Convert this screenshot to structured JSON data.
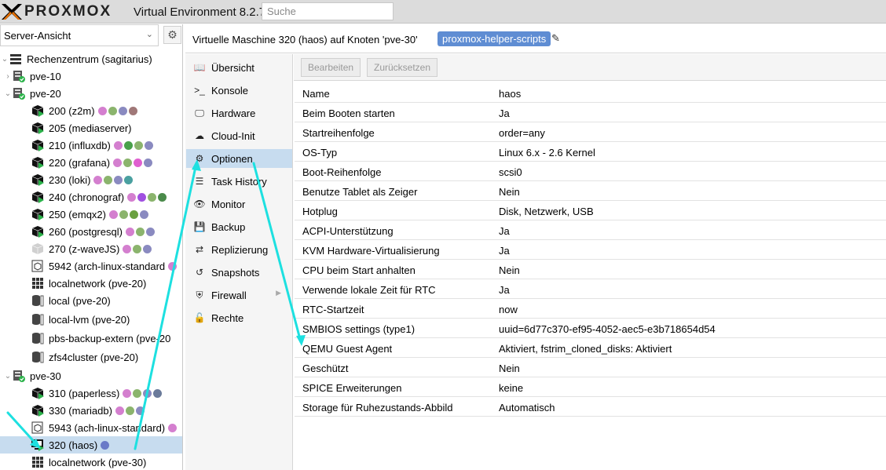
{
  "header": {
    "brand": "PROXMOX",
    "product": "Virtual Environment 8.2.7",
    "search_placeholder": "Suche"
  },
  "tree": {
    "view_label": "Server-Ansicht",
    "root": "Rechenzentrum (sagitarius)",
    "items": [
      {
        "label": "pve-10"
      },
      {
        "label": "pve-20"
      },
      {
        "label": "200 (z2m)"
      },
      {
        "label": "205 (mediaserver)"
      },
      {
        "label": "210 (influxdb)"
      },
      {
        "label": "220 (grafana)"
      },
      {
        "label": "230 (loki)"
      },
      {
        "label": "240 (chronograf)"
      },
      {
        "label": "250 (emqx2)"
      },
      {
        "label": "260 (postgresql)"
      },
      {
        "label": "270 (z-waveJS)"
      },
      {
        "label": "5942 (arch-linux-standard"
      },
      {
        "label": "localnetwork (pve-20)"
      },
      {
        "label": "local (pve-20)"
      },
      {
        "label": "local-lvm (pve-20)"
      },
      {
        "label": "pbs-backup-extern (pve-20"
      },
      {
        "label": "zfs4cluster (pve-20)"
      },
      {
        "label": "pve-30"
      },
      {
        "label": "310 (paperless)"
      },
      {
        "label": "330 (mariadb)"
      },
      {
        "label": "5943 (ach-linux-standard)"
      },
      {
        "label": "320 (haos)"
      },
      {
        "label": "localnetwork (pve-30)"
      }
    ]
  },
  "main": {
    "title": "Virtuelle Maschine 320 (haos) auf Knoten 'pve-30'",
    "tag": "proxmox-helper-scripts",
    "toolbar": {
      "edit": "Bearbeiten",
      "reset": "Zurücksetzen"
    }
  },
  "nav": [
    {
      "label": "Übersicht",
      "icon": "book-icon"
    },
    {
      "label": "Konsole",
      "icon": "terminal-icon"
    },
    {
      "label": "Hardware",
      "icon": "monitor-icon"
    },
    {
      "label": "Cloud-Init",
      "icon": "cloud-icon"
    },
    {
      "label": "Optionen",
      "icon": "gear-icon"
    },
    {
      "label": "Task History",
      "icon": "list-icon"
    },
    {
      "label": "Monitor",
      "icon": "eye-icon"
    },
    {
      "label": "Backup",
      "icon": "floppy-icon"
    },
    {
      "label": "Replizierung",
      "icon": "retweet-icon"
    },
    {
      "label": "Snapshots",
      "icon": "history-icon"
    },
    {
      "label": "Firewall",
      "icon": "shield-icon"
    },
    {
      "label": "Rechte",
      "icon": "unlock-icon"
    }
  ],
  "options": [
    {
      "key": "Name",
      "value": "haos"
    },
    {
      "key": "Beim Booten starten",
      "value": "Ja"
    },
    {
      "key": "Startreihenfolge",
      "value": "order=any"
    },
    {
      "key": "OS-Typ",
      "value": "Linux 6.x - 2.6 Kernel"
    },
    {
      "key": "Boot-Reihenfolge",
      "value": "scsi0"
    },
    {
      "key": "Benutze Tablet als Zeiger",
      "value": "Nein"
    },
    {
      "key": "Hotplug",
      "value": "Disk, Netzwerk, USB"
    },
    {
      "key": "ACPI-Unterstützung",
      "value": "Ja"
    },
    {
      "key": "KVM Hardware-Virtualisierung",
      "value": "Ja"
    },
    {
      "key": "CPU beim Start anhalten",
      "value": "Nein"
    },
    {
      "key": "Verwende lokale Zeit für RTC",
      "value": "Ja"
    },
    {
      "key": "RTC-Startzeit",
      "value": "now"
    },
    {
      "key": "SMBIOS settings (type1)",
      "value": "uuid=6d77c370-ef95-4052-aec5-e3b718654d54"
    },
    {
      "key": "QEMU Guest Agent",
      "value": "Aktiviert, fstrim_cloned_disks: Aktiviert"
    },
    {
      "key": "Geschützt",
      "value": "Nein"
    },
    {
      "key": "SPICE Erweiterungen",
      "value": "keine"
    },
    {
      "key": "Storage für Ruhezustands-Abbild",
      "value": "Automatisch"
    }
  ],
  "colors": {
    "selection": "#c7dcef",
    "tag_bg": "#5f8dd3",
    "arrow": "#1de0e0",
    "running": "#2bb34a"
  }
}
